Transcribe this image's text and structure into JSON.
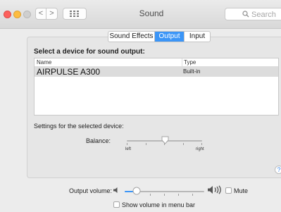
{
  "window": {
    "title": "Sound"
  },
  "toolbar": {
    "back_label": "<",
    "forward_label": ">",
    "search_placeholder": "Search"
  },
  "tabs": [
    {
      "label": "Sound Effects",
      "active": false
    },
    {
      "label": "Output",
      "active": true
    },
    {
      "label": "Input",
      "active": false
    }
  ],
  "output": {
    "heading": "Select a device for sound output:",
    "columns": {
      "name": "Name",
      "type": "Type"
    },
    "devices": [
      {
        "name": "AIRPULSE A300",
        "type": "Built-in",
        "selected": true
      }
    ],
    "settings_label": "Settings for the selected device:",
    "balance": {
      "label": "Balance:",
      "left": "left",
      "right": "right",
      "value": 0.5
    }
  },
  "help_label": "?",
  "volume": {
    "label": "Output volume:",
    "level": 0.15,
    "mute_label": "Mute",
    "mute_checked": false,
    "menu_bar_label": "Show volume in menu bar",
    "menu_bar_checked": false
  },
  "colors": {
    "accent": "#3b95f7",
    "close": "#fc605c",
    "minimize": "#fdbc40",
    "maximize": "#cfcfcf"
  },
  "icons": [
    "back-arrow-icon",
    "forward-arrow-icon",
    "grid-icon",
    "search-icon",
    "speaker-low-icon",
    "speaker-high-icon",
    "help-icon"
  ]
}
